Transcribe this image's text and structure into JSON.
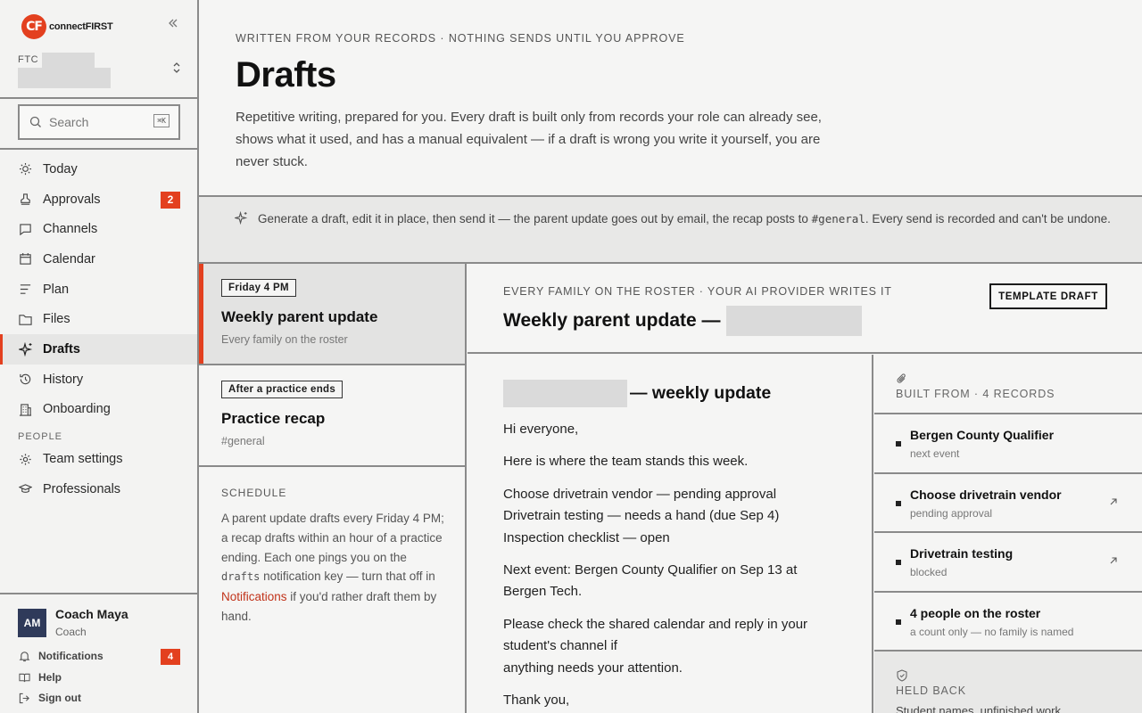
{
  "app": {
    "logo_mark": "CF",
    "logo_text": "connectFIRST",
    "collapse_icon": "double-chevron-left-icon"
  },
  "team": {
    "prefix": "FTC"
  },
  "search": {
    "placeholder": "Search",
    "shortcut": "⌘K"
  },
  "nav": {
    "items": [
      {
        "label": "Today",
        "icon": "sun-icon"
      },
      {
        "label": "Approvals",
        "icon": "stamp-icon",
        "badge": "2"
      },
      {
        "label": "Channels",
        "icon": "chat-bubble-icon"
      },
      {
        "label": "Calendar",
        "icon": "calendar-icon"
      },
      {
        "label": "Plan",
        "icon": "list-icon"
      },
      {
        "label": "Files",
        "icon": "folder-icon"
      },
      {
        "label": "Drafts",
        "icon": "sparkle-icon",
        "active": true
      },
      {
        "label": "History",
        "icon": "history-icon"
      },
      {
        "label": "Onboarding",
        "icon": "building-icon"
      }
    ],
    "section_people": "PEOPLE",
    "people_items": [
      {
        "label": "Team settings",
        "icon": "gear-icon"
      },
      {
        "label": "Professionals",
        "icon": "graduation-cap-icon"
      }
    ]
  },
  "user": {
    "initials": "AM",
    "name": "Coach Maya",
    "role": "Coach",
    "links": {
      "notifications": "Notifications",
      "notifications_badge": "4",
      "help": "Help",
      "sign_out": "Sign out"
    }
  },
  "header": {
    "eyebrow": "WRITTEN FROM YOUR RECORDS · NOTHING SENDS UNTIL YOU APPROVE",
    "title": "Drafts",
    "intro": "Repetitive writing, prepared for you. Every draft is built only from records your role can already see, shows what it used, and has a manual equivalent — if a draft is wrong you write it yourself, you are never stuck."
  },
  "info_bar": {
    "text_before": "Generate a draft, edit it in place, then send it — the parent update goes out by email, the recap posts to ",
    "code": "#general",
    "text_after": ". Every send is recorded and can't be undone."
  },
  "drafts": [
    {
      "tag": "Friday 4 PM",
      "title": "Weekly parent update",
      "subtitle": "Every family on the roster",
      "selected": true
    },
    {
      "tag": "After a practice ends",
      "title": "Practice recap",
      "subtitle": "#general",
      "selected": false
    }
  ],
  "schedule": {
    "heading": "SCHEDULE",
    "text_1": "A parent update drafts every Friday 4 PM; a recap drafts within an hour of a practice ending. Each one pings you on the ",
    "code": "drafts",
    "text_2": " notification key — turn that off in ",
    "link": "Notifications",
    "text_3": " if you'd rather draft them by hand."
  },
  "detail": {
    "eyebrow": "EVERY FAMILY ON THE ROSTER · YOUR AI PROVIDER WRITES IT",
    "title": "Weekly parent update —",
    "template_button": "TEMPLATE DRAFT"
  },
  "email": {
    "title_suffix": "— weekly update",
    "greeting": "Hi everyone,",
    "intro": "Here is where the team stands this week.",
    "status_lines": [
      "Choose drivetrain vendor — pending approval",
      "Drivetrain testing — needs a hand (due Sep 4)",
      "Inspection checklist — open"
    ],
    "next_event": "Next event: Bergen County Qualifier on Sep 13 at Bergen Tech.",
    "request_1": "Please check the shared calendar and reply in your student's channel if",
    "request_2": "anything needs your attention.",
    "sign_off": "Thank you,"
  },
  "sources": {
    "heading": "BUILT FROM · 4 RECORDS",
    "items": [
      {
        "name": "Bergen County Qualifier",
        "meta": "next event",
        "link": false
      },
      {
        "name": "Choose drivetrain vendor",
        "meta": "pending approval",
        "link": true
      },
      {
        "name": "Drivetrain testing",
        "meta": "blocked",
        "link": true
      },
      {
        "name": "4 people on the roster",
        "meta": "a count only — no family is named",
        "link": false
      }
    ],
    "held_heading": "HELD BACK",
    "held_text": "Student names, unfinished work"
  },
  "colors": {
    "accent": "#e3401f",
    "border": "#8a8a8a",
    "avatar": "#2f3a5a"
  }
}
